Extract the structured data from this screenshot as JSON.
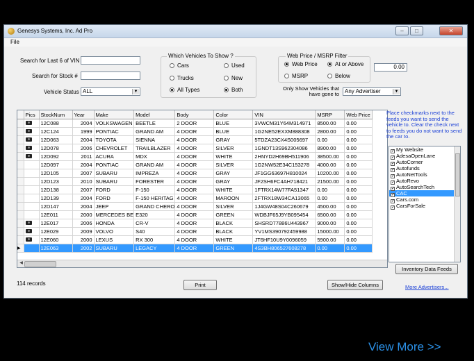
{
  "window": {
    "title": "Genesys Systems, Inc. Ad Pro",
    "menu": [
      "File"
    ],
    "controls": {
      "minimize": "–",
      "maximize": "□",
      "close": "✕"
    }
  },
  "filters": {
    "vin_label": "Search for Last 6 of VIN",
    "vin_value": "",
    "stock_label": "Search for Stock #",
    "stock_value": "",
    "status_label": "Vehicle Status",
    "status_value": "ALL"
  },
  "which_vehicles": {
    "title": "Which Vehicles To Show ?",
    "options": [
      "Cars",
      "Trucks",
      "All Types",
      "Used",
      "New",
      "Both"
    ],
    "selected": [
      "All Types",
      "Both"
    ]
  },
  "price_filter": {
    "title": "Web Price / MSRP Filter",
    "options": [
      "Web Price",
      "MSRP",
      "At or Above",
      "Below"
    ],
    "selected": [
      "Web Price",
      "At or Above"
    ],
    "value": "0.00",
    "advertiser_label": "Only Show Vehicles that have gone to",
    "advertiser_value": "Any Advertiser"
  },
  "table": {
    "columns": [
      "Pics",
      "StockNum",
      "Year",
      "Make",
      "Model",
      "Body",
      "Color",
      "VIN",
      "MSRP",
      "Web Price"
    ],
    "rows": [
      {
        "pic": true,
        "stock": "12C088",
        "year": "2004",
        "make": "VOLKSWAGEN",
        "model": "BEETLE",
        "body": "2 DOOR",
        "color": "BLUE",
        "vin": "3VWCM31Y64M314971",
        "msrp": "8500.00",
        "web": "0.00"
      },
      {
        "pic": true,
        "stock": "12C124",
        "year": "1999",
        "make": "PONTIAC",
        "model": "GRAND AM",
        "body": "4 DOOR",
        "color": "BLUE",
        "vin": "1G2NE52EXXM888308",
        "msrp": "2800.00",
        "web": "0.00"
      },
      {
        "pic": true,
        "stock": "12D063",
        "year": "2004",
        "make": "TOYOTA",
        "model": "SIENNA",
        "body": "4 DOOR",
        "color": "GRAY",
        "vin": "5TDZA23CX4S005697",
        "msrp": "0.00",
        "web": "0.00"
      },
      {
        "pic": true,
        "stock": "12D078",
        "year": "2006",
        "make": "CHEVROLET",
        "model": "TRAILBLAZER",
        "body": "4 DOOR",
        "color": "SILVER",
        "vin": "1GNDT13S962304086",
        "msrp": "8900.00",
        "web": "0.00"
      },
      {
        "pic": true,
        "stock": "12D092",
        "year": "2011",
        "make": "ACURA",
        "model": "MDX",
        "body": "4 DOOR",
        "color": "WHITE",
        "vin": "2HNYD2H69BH511906",
        "msrp": "38500.00",
        "web": "0.00"
      },
      {
        "pic": false,
        "stock": "12D097",
        "year": "2004",
        "make": "PONTIAC",
        "model": "GRAND AM",
        "body": "4 DOOR",
        "color": "SILVER",
        "vin": "1G2NW52E34C153278",
        "msrp": "4000.00",
        "web": "0.00"
      },
      {
        "pic": false,
        "stock": "12D105",
        "year": "2007",
        "make": "SUBARU",
        "model": "IMPREZA",
        "body": "4 DOOR",
        "color": "GRAY",
        "vin": "JF1GG63697H810024",
        "msrp": "10200.00",
        "web": "0.00"
      },
      {
        "pic": false,
        "stock": "12D123",
        "year": "2010",
        "make": "SUBARU",
        "model": "FORESTER",
        "body": "4 DOOR",
        "color": "GRAY",
        "vin": "JF2SH6FC4AH718421",
        "msrp": "21500.00",
        "web": "0.00"
      },
      {
        "pic": false,
        "stock": "12D138",
        "year": "2007",
        "make": "FORD",
        "model": "F-150",
        "body": "4 DOOR",
        "color": "WHITE",
        "vin": "1FTRX14W77FA51347",
        "msrp": "0.00",
        "web": "0.00"
      },
      {
        "pic": false,
        "stock": "12D139",
        "year": "2004",
        "make": "FORD",
        "model": "F-150 HERITAG",
        "body": "4 DOOR",
        "color": "MAROON",
        "vin": "2FTRX18W34CA13065",
        "msrp": "0.00",
        "web": "0.00"
      },
      {
        "pic": false,
        "stock": "12D147",
        "year": "2004",
        "make": "JEEP",
        "model": "GRAND CHERO",
        "body": "4 DOOR",
        "color": "SILVER",
        "vin": "1J4GW48S04C260679",
        "msrp": "4500.00",
        "web": "0.00"
      },
      {
        "pic": false,
        "stock": "12E011",
        "year": "2000",
        "make": "MERCEDES BE",
        "model": "E320",
        "body": "4 DOOR",
        "color": "GREEN",
        "vin": "WDBJF65J9YB095454",
        "msrp": "6500.00",
        "web": "0.00"
      },
      {
        "pic": true,
        "stock": "12E017",
        "year": "2006",
        "make": "HONDA",
        "model": "CR-V",
        "body": "4 DOOR",
        "color": "BLACK",
        "vin": "SHSRD77886U443967",
        "msrp": "9000.00",
        "web": "0.00"
      },
      {
        "pic": true,
        "stock": "12E029",
        "year": "2009",
        "make": "VOLVO",
        "model": "S40",
        "body": "4 DOOR",
        "color": "BLACK",
        "vin": "YV1MS390792459988",
        "msrp": "15000.00",
        "web": "0.00"
      },
      {
        "pic": true,
        "stock": "12E060",
        "year": "2000",
        "make": "LEXUS",
        "model": "RX 300",
        "body": "4 DOOR",
        "color": "WHITE",
        "vin": "JT6HF10U9Y0096059",
        "msrp": "5900.00",
        "web": "0.00"
      },
      {
        "pic": false,
        "stock": "12E063",
        "year": "2002",
        "make": "SUBARU",
        "model": "LEGACY",
        "body": "4 DOOR",
        "color": "GREEN",
        "vin": "4S3BH806527608278",
        "msrp": "0.00",
        "web": "0.00",
        "selected": true
      }
    ]
  },
  "record_count": "114 records",
  "buttons": {
    "print": "Print",
    "show_hide": "Show/Hide Columns",
    "inventory_feeds": "Inventory Data Feeds"
  },
  "help_text": "Place checkmarks next to the feeds you want to send the vehicle to.  Clear the check next to feeds you do not want to send the car to.",
  "feeds": [
    {
      "name": "My Website",
      "checked": true
    },
    {
      "name": "AdesaOpenLane",
      "checked": true
    },
    {
      "name": "AutoCorner",
      "checked": true
    },
    {
      "name": "Autofunds",
      "checked": true
    },
    {
      "name": "AutoNetTools",
      "checked": true
    },
    {
      "name": "AutoRevo",
      "checked": true
    },
    {
      "name": "AutoSearchTech",
      "checked": true
    },
    {
      "name": "CAC",
      "checked": true,
      "selected": true
    },
    {
      "name": "Cars.com",
      "checked": true
    },
    {
      "name": "CarsForSale",
      "checked": true
    }
  ],
  "more_advertisers": "More Advertisers...",
  "view_more": "View More >>"
}
